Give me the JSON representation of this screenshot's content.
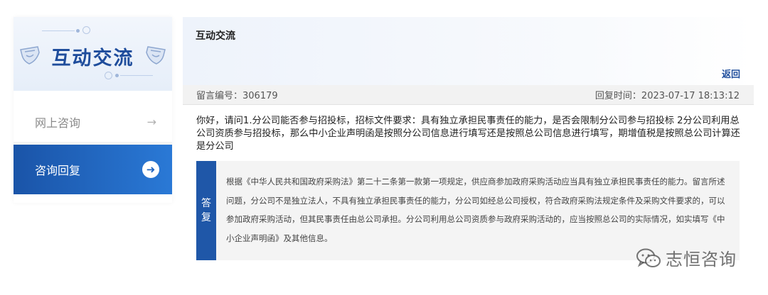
{
  "sidebar": {
    "banner_title": "互动交流",
    "items": [
      {
        "label": "网上咨询",
        "active": false
      },
      {
        "label": "咨询回复",
        "active": true
      }
    ]
  },
  "main": {
    "title": "互动交流",
    "back_label": "返回",
    "message_id_label": "留言编号：306179",
    "reply_time_label": "回复时间：2023-07-17 18:13:12",
    "question": "你好，请问1.分公司能否参与招投标，招标文件要求：具有独立承担民事责任的能力，是否会限制分公司参与招投标 2分公司利用总公司资质参与招投标，那么中小企业声明函是按照分公司信息进行填写还是按照总公司信息进行填写，期增值税是按照总公司计算还是分公司",
    "answer_tag_1": "答",
    "answer_tag_2": "复",
    "answer": "根据《中华人民共和国政府采购法》第二十二条第一款第一项规定，供应商参加政府采购活动应当具有独立承担民事责任的能力。留言所述问题，分公司不是独立法人，不具有独立承担民事责任的能力，分公司如经总公司授权，符合政府采购法规定条件及采购文件要求的，可以参加政府采购活动，但其民事责任由总公司承担。分公司利用总公司资质参与政府采购活动的，应当按照总公司的实际情况，如实填写《中小企业声明函》及其他信息。"
  },
  "watermark": {
    "text": "志恒咨询",
    "icon": "wechat-icon"
  },
  "colors": {
    "brand_blue": "#1f4d9c",
    "active_gradient_start": "#1a54a8",
    "active_gradient_end": "#2a79d6",
    "answer_tag": "#1f57a8"
  },
  "icons": {
    "nav_arrow": "arrow-right-icon",
    "active_arrow": "circle-arrow-right-icon"
  }
}
